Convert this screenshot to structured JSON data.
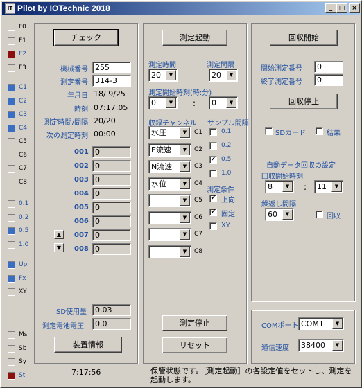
{
  "window": {
    "title": "Pilot by IOTechnic 2018",
    "app_icon": "IT",
    "minimize_glyph": "_",
    "maximize_glyph": "□",
    "close_glyph": "×"
  },
  "indicators": {
    "group1": [
      {
        "label": "F0",
        "state": "off"
      },
      {
        "label": "F1",
        "state": "off"
      },
      {
        "label": "F2",
        "state": "red"
      },
      {
        "label": "F3",
        "state": "off"
      }
    ],
    "group2": [
      {
        "label": "C1",
        "state": "blue"
      },
      {
        "label": "C2",
        "state": "blue"
      },
      {
        "label": "C3",
        "state": "blue"
      },
      {
        "label": "C4",
        "state": "blue"
      },
      {
        "label": "C5",
        "state": "off"
      },
      {
        "label": "C6",
        "state": "off"
      },
      {
        "label": "C7",
        "state": "off"
      },
      {
        "label": "C8",
        "state": "off"
      }
    ],
    "group3": [
      {
        "label": "0.1",
        "state": "off"
      },
      {
        "label": "0.2",
        "state": "off"
      },
      {
        "label": "0.5",
        "state": "blue"
      },
      {
        "label": "1.0",
        "state": "off"
      }
    ],
    "group4": [
      {
        "label": "Up",
        "state": "blue"
      },
      {
        "label": "Fx",
        "state": "blue"
      },
      {
        "label": "XY",
        "state": "off"
      }
    ],
    "group5": [
      {
        "label": "Ms",
        "state": "off"
      },
      {
        "label": "Sb",
        "state": "off"
      },
      {
        "label": "Sy",
        "state": "off"
      },
      {
        "label": "St",
        "state": "red"
      }
    ]
  },
  "left": {
    "check_button": "チェック",
    "rows": [
      {
        "label": "機械番号",
        "value": "255"
      },
      {
        "label": "測定番号",
        "value": "314-3"
      },
      {
        "label": "年月日",
        "value": "18/ 9/25"
      },
      {
        "label": "時刻",
        "value": "07:17:05"
      },
      {
        "label": "測定時間/間隔",
        "value": "20/20"
      },
      {
        "label": "次の測定時刻",
        "value": "00:00"
      }
    ],
    "channels": [
      {
        "label": "001",
        "value": "0"
      },
      {
        "label": "002",
        "value": "0"
      },
      {
        "label": "003",
        "value": "0"
      },
      {
        "label": "004",
        "value": "0"
      },
      {
        "label": "005",
        "value": "0"
      },
      {
        "label": "006",
        "value": "0"
      },
      {
        "label": "007",
        "value": "0"
      },
      {
        "label": "008",
        "value": "0"
      }
    ],
    "up_arrow": "▲",
    "down_arrow": "▼",
    "sd_label": "SD使用量",
    "sd_value": "0.03",
    "battery_label": "測定電池電圧",
    "battery_value": "0.0",
    "device_info_button": "装置情報"
  },
  "middle": {
    "start_button": "測定起動",
    "time_label": "測定時間",
    "time_value": "20",
    "interval_label": "測定間隔",
    "interval_value": "20",
    "start_time_label": "測定開始時刻(時:分)",
    "start_hour": "0",
    "start_min": "0",
    "colon": ":",
    "channel_label": "収録チャンネル",
    "sampling_label": "サンプル間隔",
    "channels": [
      {
        "value": "水圧",
        "tag": "C1"
      },
      {
        "value": "E流速",
        "tag": "C2"
      },
      {
        "value": "N流速",
        "tag": "C3"
      },
      {
        "value": "水位",
        "tag": "C4"
      },
      {
        "value": "",
        "tag": "C5"
      },
      {
        "value": "",
        "tag": "C6"
      },
      {
        "value": "",
        "tag": "C7"
      },
      {
        "value": "",
        "tag": "C8"
      }
    ],
    "sampling": [
      {
        "label": "0.1",
        "checked": false
      },
      {
        "label": "0.2",
        "checked": false
      },
      {
        "label": "0.5",
        "checked": true
      },
      {
        "label": "1.0",
        "checked": false
      }
    ],
    "cond_label": "測定条件",
    "conditions": [
      {
        "label": "上向",
        "checked": true
      },
      {
        "label": "固定",
        "checked": true
      },
      {
        "label": "XY",
        "checked": false
      }
    ],
    "stop_button": "測定停止",
    "reset_button": "リセット"
  },
  "right": {
    "collect_start_button": "回収開始",
    "start_num_label": "開始測定番号",
    "start_num_value": "0",
    "end_num_label": "終了測定番号",
    "end_num_value": "0",
    "collect_stop_button": "回収停止",
    "sd_card_label": "SDカード",
    "result_label": "結果",
    "auto_label": "自動データ回収の設定",
    "collect_time_label": "回収開始時刻",
    "collect_hour": "8",
    "collect_min": "11",
    "colon": ":",
    "repeat_label": "繰返し間隔",
    "repeat_value": "60",
    "collect_label": "回収",
    "com_label": "COMポート",
    "com_value": "COM1",
    "baud_label": "通信速度",
    "baud_value": "38400"
  },
  "status": {
    "time": "7:17:56",
    "message": "保管状態です。［測定起動］の各設定値をセットし、測定を起動します。"
  },
  "colors": {
    "accent_label": "#1f4fa0",
    "led_red": "#8b1010",
    "led_blue": "#3a6ec2"
  }
}
